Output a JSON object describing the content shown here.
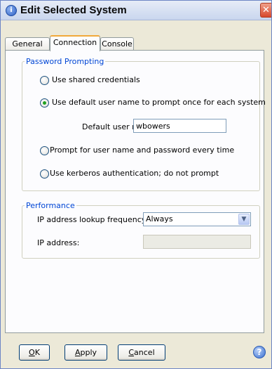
{
  "window": {
    "title": "Edit Selected System",
    "title_icon": "info-icon",
    "close_glyph": "✕"
  },
  "tabs": [
    {
      "label": "General"
    },
    {
      "label": "Connection",
      "selected": true
    },
    {
      "label": "Console"
    }
  ],
  "password_prompting": {
    "legend": "Password Prompting",
    "options": [
      {
        "label": "Use shared credentials",
        "checked": false
      },
      {
        "label": "Use default user name to prompt once for each system",
        "checked": true
      },
      {
        "label": "Prompt for user name and password every time",
        "checked": false
      },
      {
        "label": "Use kerberos authentication; do not prompt",
        "checked": false
      }
    ],
    "default_user": {
      "label": "Default user name:",
      "value": "wbowers"
    }
  },
  "performance": {
    "legend": "Performance",
    "lookup_label": "IP address lookup frequency:",
    "lookup_value": "Always",
    "ip_label": "IP address:",
    "ip_value": ""
  },
  "buttons": {
    "ok": {
      "mnemonic": "O",
      "rest": "K"
    },
    "apply": {
      "mnemonic": "A",
      "rest": "pply"
    },
    "cancel": {
      "mnemonic": "C",
      "rest": "ancel"
    }
  },
  "help_glyph": "?",
  "colors": {
    "accent": "#0046d5",
    "tab_highlight": "#f1a93a",
    "radio_check": "#21a121"
  }
}
